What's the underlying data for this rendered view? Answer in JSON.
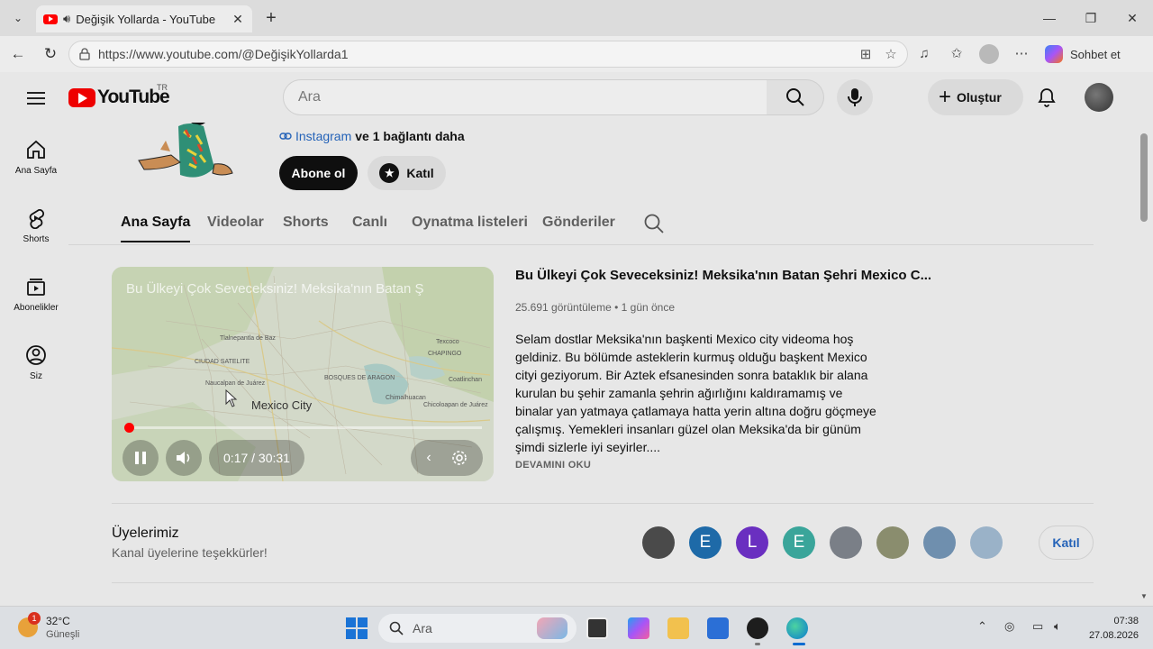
{
  "browser": {
    "tab_title": "Değişik Yollarda - YouTube",
    "url": "https://www.youtube.com/@DeğişikYollarda1",
    "copilot_label": "Sohbet et"
  },
  "youtube": {
    "logo_text": "YouTube",
    "country_code": "TR",
    "search_placeholder": "Ara",
    "create_label": "Oluştur",
    "left_nav": [
      {
        "label": "Ana Sayfa",
        "icon": "home-icon"
      },
      {
        "label": "Shorts",
        "icon": "shorts-icon"
      },
      {
        "label": "Abonelikler",
        "icon": "subscriptions-icon"
      },
      {
        "label": "Siz",
        "icon": "you-icon"
      }
    ]
  },
  "channel": {
    "link_instagram": "Instagram",
    "link_more": "ve 1 bağlantı daha",
    "subscribe_label": "Abone ol",
    "join_label": "Katıl",
    "tabs": [
      "Ana Sayfa",
      "Videolar",
      "Shorts",
      "Canlı",
      "Oynatma listeleri",
      "Gönderiler"
    ],
    "active_tab": "Ana Sayfa"
  },
  "featured_video": {
    "title": "Bu Ülkeyi Çok Seveceksiniz! Meksika'nın Batan Şehri Mexico C...",
    "overlay_title": "Bu Ülkeyi Çok Seveceksiniz! Meksika'nın Batan Ş",
    "views": "25.691 görüntüleme",
    "age": "1 gün önce",
    "description": "Selam dostlar Meksika'nın başkenti Mexico city videoma hoş geldiniz. Bu bölümde asteklerin kurmuş olduğu başkent Mexico cityi geziyorum. Bir Aztek efsanesinden sonra bataklık bir alana kurulan bu şehir zamanla şehrin ağırlığını kaldıramamış ve binalar yan yatmaya çatlamaya hatta yerin altına doğru göçmeye çalışmış. Yemekleri insanları güzel olan Meksika'da bir günüm şimdi sizlerle iyi seyirler....",
    "read_more": "DEVAMINI OKU",
    "time": "0:17 / 30:31",
    "progress_fraction": 0.009,
    "map_city": "Mexico City",
    "map_labels": [
      "Tlalnepantla de Baz",
      "CIUDAD SATELITE",
      "Naucalpan de Juárez",
      "BOSQUES DE ARAGON",
      "Texcoco",
      "CHAPINGO",
      "Coatlinchan",
      "Chimalhuacan",
      "Chicoloapan de Juárez"
    ]
  },
  "members": {
    "title": "Üyelerimiz",
    "subtitle": "Kanal üyelerine teşekkürler!",
    "join_label": "Katıl",
    "avatars": [
      {
        "letter": "",
        "color": "#4a4a4a"
      },
      {
        "letter": "E",
        "color": "#1e6aa8"
      },
      {
        "letter": "L",
        "color": "#6a2fc0"
      },
      {
        "letter": "E",
        "color": "#3aa59a"
      },
      {
        "letter": "",
        "color": "#7a7f87"
      },
      {
        "letter": "",
        "color": "#8a8d6e"
      },
      {
        "letter": "",
        "color": "#6f8fae"
      },
      {
        "letter": "",
        "color": "#9ab2c8"
      }
    ]
  },
  "taskbar": {
    "temperature": "32°C",
    "weather": "Güneşli",
    "weather_badge": "1",
    "search_placeholder": "Ara",
    "time": "07:38",
    "date": "27.08.2026"
  }
}
